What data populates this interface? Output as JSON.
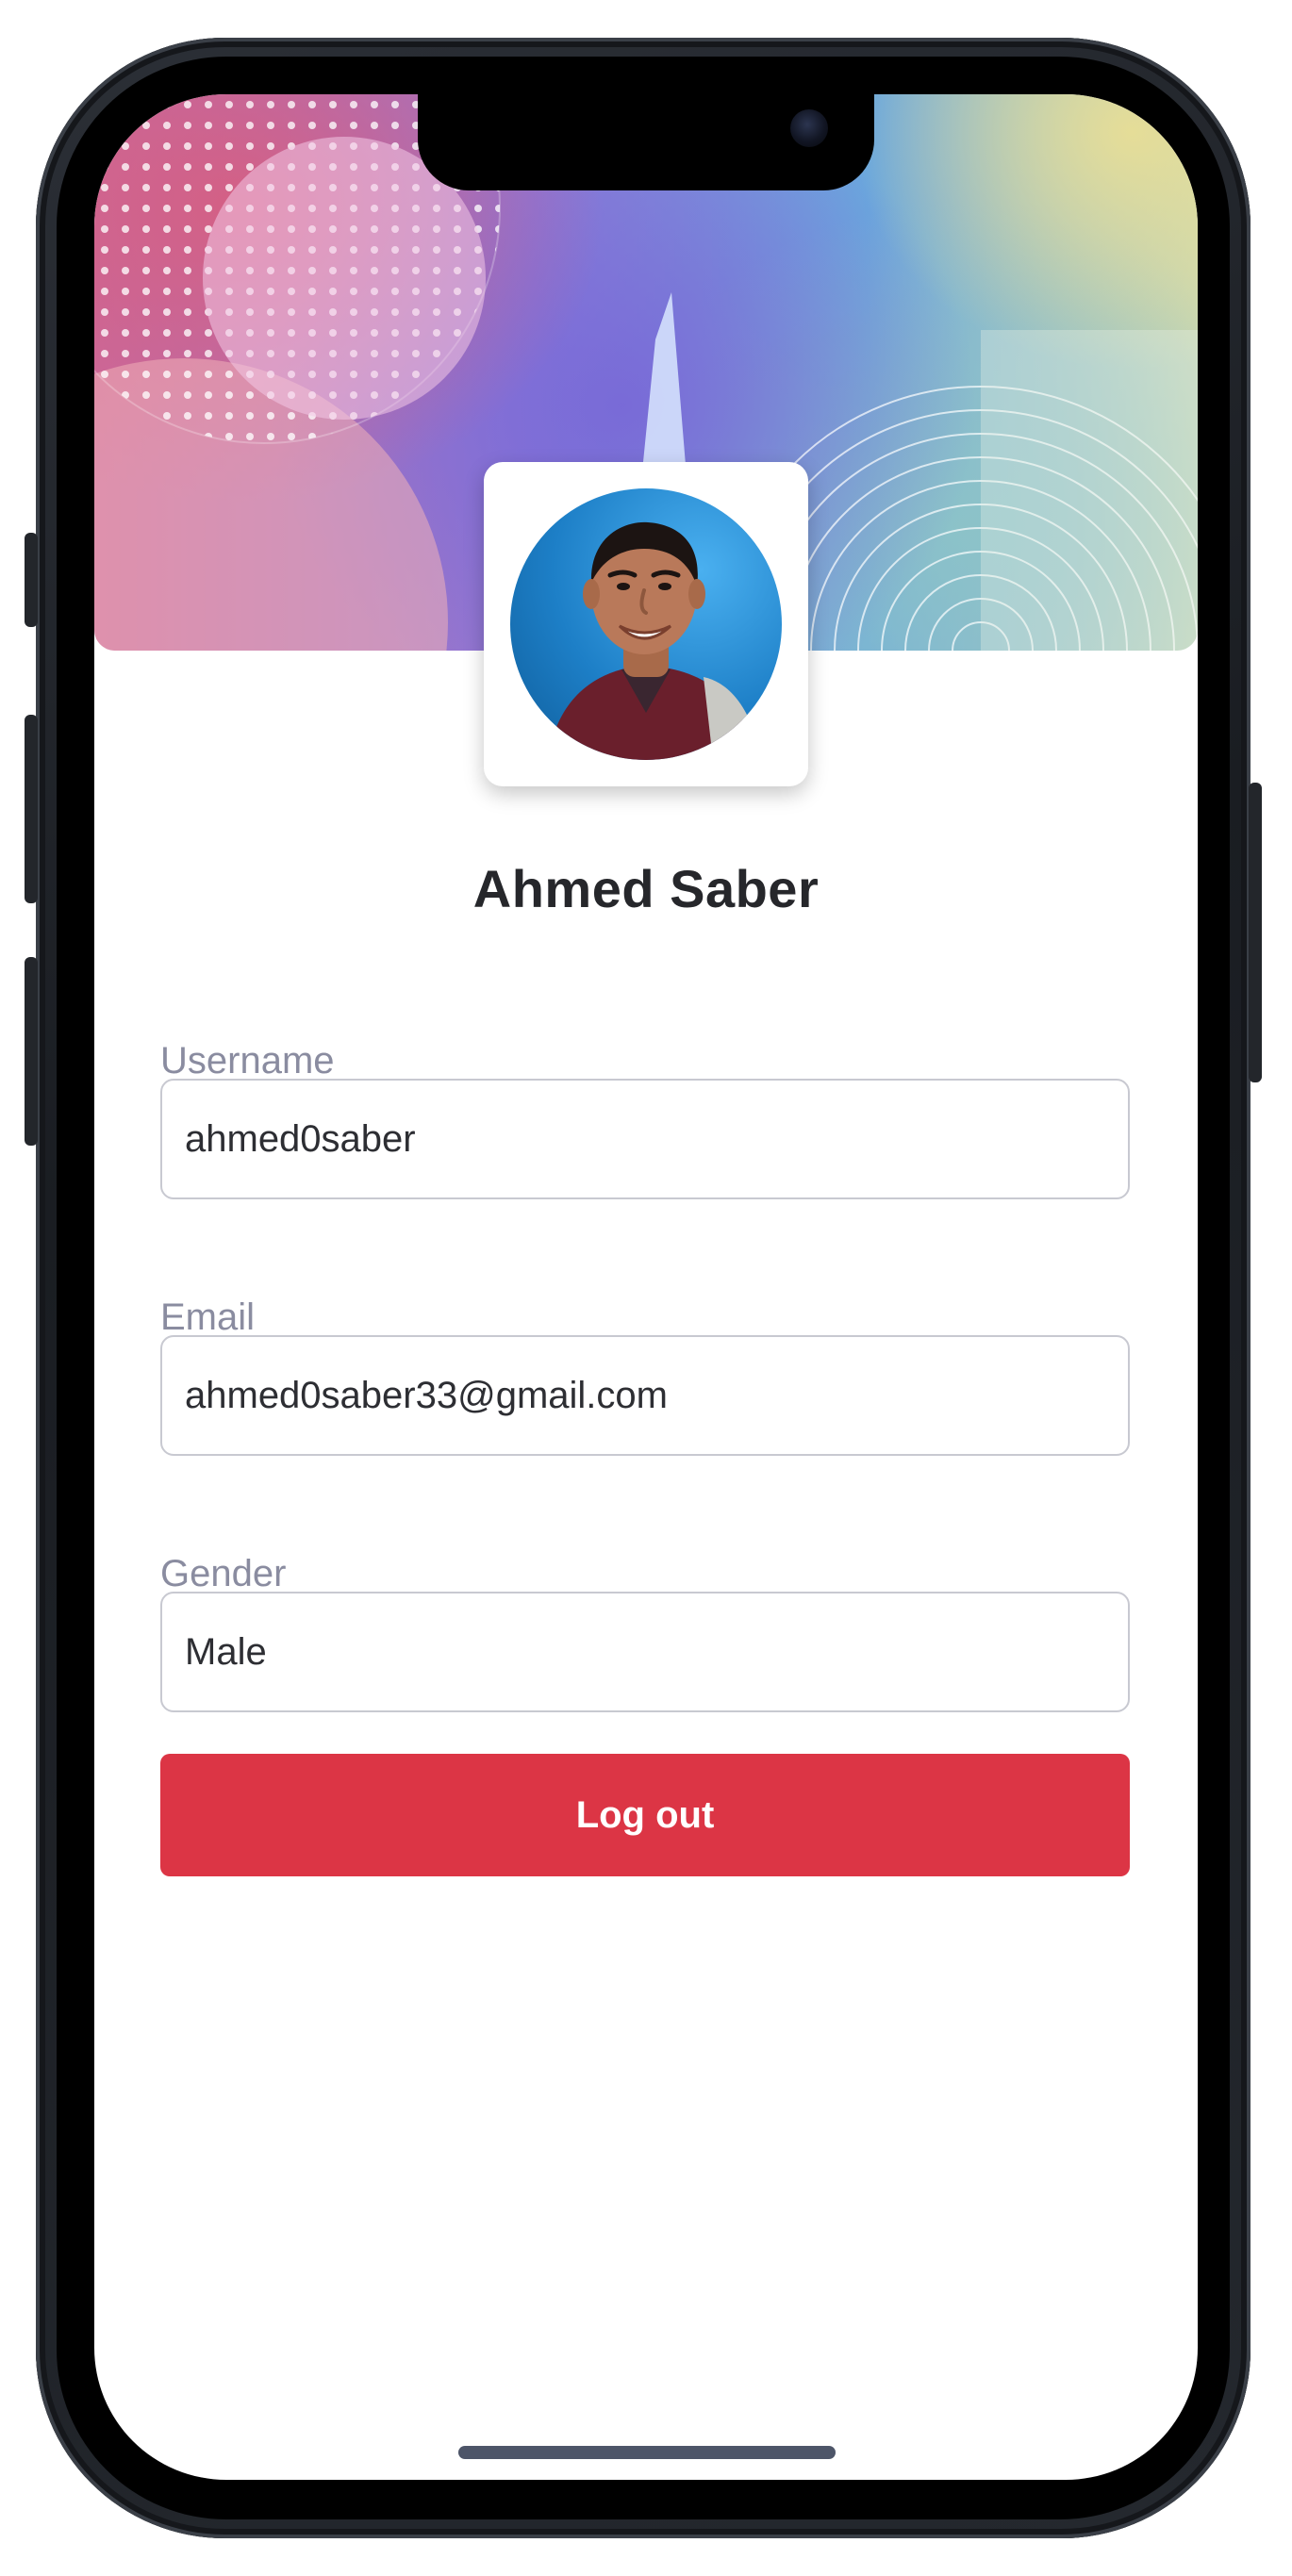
{
  "profile": {
    "name": "Ahmed Saber"
  },
  "fields": {
    "username": {
      "label": "Username",
      "value": "ahmed0saber"
    },
    "email": {
      "label": "Email",
      "value": "ahmed0saber33@gmail.com"
    },
    "gender": {
      "label": "Gender",
      "value": "Male"
    }
  },
  "actions": {
    "logout_label": "Log out"
  },
  "colors": {
    "logout_button": "#dc3545",
    "name_text": "#26272b",
    "label_text": "#8a8ca0",
    "field_border": "#c8c9d1",
    "home_indicator": "#4d5568"
  },
  "icons": {
    "avatar": "user-photo",
    "camera": "front-camera"
  }
}
